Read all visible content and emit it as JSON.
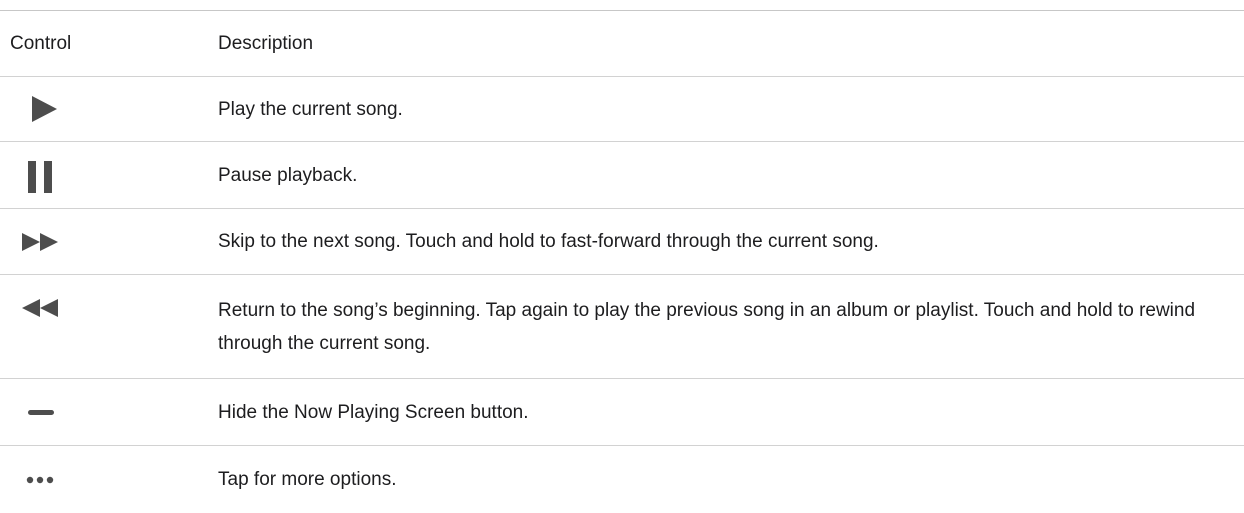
{
  "table": {
    "headers": {
      "control": "Control",
      "description": "Description"
    },
    "rows": [
      {
        "icon": "play-icon",
        "description": "Play the current song."
      },
      {
        "icon": "pause-icon",
        "description": "Pause playback."
      },
      {
        "icon": "fast-forward-icon",
        "description": "Skip to the next song. Touch and hold to fast-forward through the current song."
      },
      {
        "icon": "rewind-icon",
        "description": "Return to the song’s beginning. Tap again to play the previous song in an album or playlist. Touch and hold to rewind through the current song."
      },
      {
        "icon": "minimize-bar-icon",
        "description": "Hide the Now Playing Screen button."
      },
      {
        "icon": "more-options-icon",
        "description": "Tap for more options."
      }
    ]
  },
  "colors": {
    "icon": "#4d4d4d",
    "text": "#1d1d1f",
    "divider": "#d2d2d2"
  }
}
